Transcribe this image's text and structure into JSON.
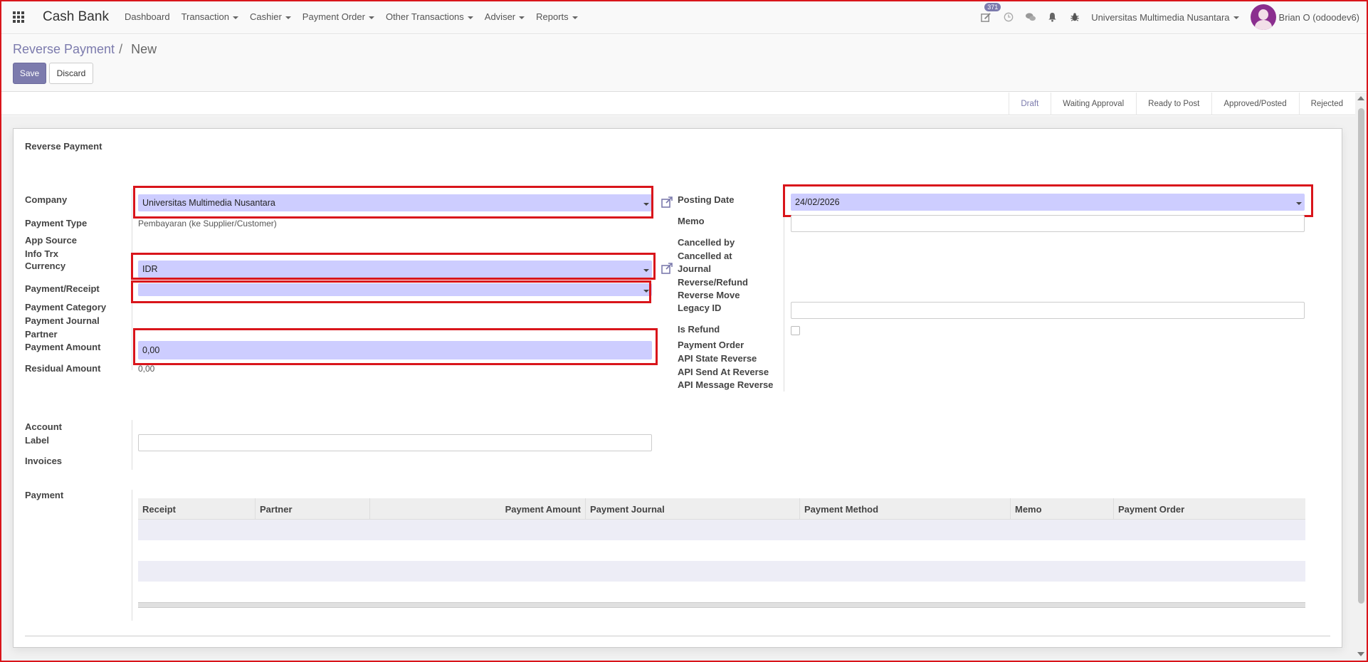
{
  "app": {
    "title": "Cash Bank"
  },
  "menu": [
    "Dashboard",
    "Transaction",
    "Cashier",
    "Payment Order",
    "Other Transactions",
    "Adviser",
    "Reports"
  ],
  "systray": {
    "activity_count": "371",
    "company": "Universitas Multimedia Nusantara",
    "user": "Brian O (odoodev6)"
  },
  "breadcrumb": {
    "parent": "Reverse Payment",
    "separator": "/",
    "current": "New"
  },
  "buttons": {
    "save": "Save",
    "discard": "Discard"
  },
  "stages": [
    "Draft",
    "Waiting Approval",
    "Ready to Post",
    "Approved/Posted",
    "Rejected"
  ],
  "active_stage": "Draft",
  "form": {
    "title": "Reverse Payment",
    "left_labels": {
      "company": "Company",
      "payment_type": "Payment Type",
      "app_source": "App Source",
      "info_trx": "Info Trx",
      "currency": "Currency",
      "payment_receipt": "Payment/Receipt",
      "payment_category": "Payment Category",
      "payment_journal": "Payment Journal",
      "partner": "Partner",
      "payment_amount": "Payment Amount",
      "residual_amount": "Residual Amount"
    },
    "left_values": {
      "company": "Universitas Multimedia Nusantara",
      "payment_type": "Pembayaran (ke Supplier/Customer)",
      "currency": "IDR",
      "payment_receipt": "",
      "payment_amount": "0,00",
      "residual_amount": "0,00"
    },
    "right_labels": {
      "posting_date": "Posting Date",
      "memo": "Memo",
      "cancelled_by": "Cancelled by",
      "cancelled_at": "Cancelled at",
      "journal": "Journal",
      "reverse_refund": "Reverse/Refund",
      "reverse_move": "Reverse Move",
      "legacy_id": "Legacy ID",
      "is_refund": "Is Refund",
      "payment_order": "Payment Order",
      "api_state_reverse": "API State Reverse",
      "api_send_at_reverse": "API Send At Reverse",
      "api_message_reverse": "API Message Reverse"
    },
    "right_values": {
      "posting_date": "24/02/2026",
      "memo": "",
      "legacy_id": ""
    },
    "lower_labels": {
      "account": "Account",
      "label": "Label",
      "invoices": "Invoices",
      "payment": "Payment"
    }
  },
  "payment_table": {
    "columns": [
      "Receipt",
      "Partner",
      "Payment Amount",
      "Payment Journal",
      "Payment Method",
      "Memo",
      "Payment Order"
    ],
    "rows": []
  },
  "colors": {
    "accent": "#7c7bad",
    "highlight": "#d9151b",
    "field_fill": "#cdcdff"
  }
}
